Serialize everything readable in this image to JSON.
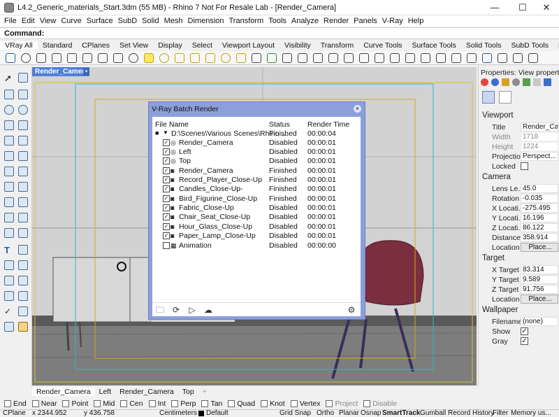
{
  "window": {
    "title": "L4.2_Generic_materials_Start.3dm (55 MB) - Rhino 7 Not For Resale Lab - [Render_Camera]",
    "controls": {
      "minimize": "—",
      "maximize": "☐",
      "close": "✕"
    }
  },
  "menu": [
    "File",
    "Edit",
    "View",
    "Curve",
    "Surface",
    "SubD",
    "Solid",
    "Mesh",
    "Dimension",
    "Transform",
    "Tools",
    "Analyze",
    "Render",
    "Panels",
    "V-Ray",
    "Help"
  ],
  "command": {
    "label": "Command:"
  },
  "toolbar_tabs": [
    "VRay All",
    "Standard",
    "CPlanes",
    "Set View",
    "Display",
    "Select",
    "Viewport Layout",
    "Visibility",
    "Transform",
    "Curve Tools",
    "Surface Tools",
    "Solid Tools",
    "SubD Tools",
    "Mesh"
  ],
  "viewport": {
    "active_tab": "Render_Camera",
    "dropdown_glyph": "▾"
  },
  "viewport_tabs": [
    "Render_Camera",
    "Left",
    "Render_Camera",
    "Top"
  ],
  "add_tab_glyph": "+",
  "batch_render": {
    "title": "V-Ray Batch Render",
    "close_glyph": "×",
    "headers": {
      "file": "File Name",
      "status": "Status",
      "time": "Render Time"
    },
    "root": {
      "name": "D:\\Scenes\\Various Scenes\\Rhino ...",
      "status": "Finished",
      "time": "00:00:04",
      "toggle": "▼",
      "marker": "■"
    },
    "rows": [
      {
        "name": "Render_Camera",
        "status": "Disabled",
        "time": "00:00:01",
        "icon": "◎",
        "checked": "✓"
      },
      {
        "name": "Left",
        "status": "Disabled",
        "time": "00:00:01",
        "icon": "◎",
        "checked": "✓"
      },
      {
        "name": "Top",
        "status": "Disabled",
        "time": "00:00:01",
        "icon": "◎",
        "checked": "✓"
      },
      {
        "name": "Render_Camera",
        "status": "Finished",
        "time": "00:00:01",
        "icon": "◙",
        "checked": "✓"
      },
      {
        "name": "Record_Player_Close-Up",
        "status": "Finished",
        "time": "00:00:01",
        "icon": "◙",
        "checked": "✓"
      },
      {
        "name": "Candles_Close-Up-",
        "status": "Finished",
        "time": "00:00:01",
        "icon": "◙",
        "checked": "✓"
      },
      {
        "name": "Bird_Figurine_Close-Up",
        "status": "Finished",
        "time": "00:00:01",
        "icon": "◙",
        "checked": "✓"
      },
      {
        "name": "Fabric_Close-Up",
        "status": "Disabled",
        "time": "00:00:01",
        "icon": "◙",
        "checked": "✓"
      },
      {
        "name": "Chair_Seat_Close-Up",
        "status": "Disabled",
        "time": "00:00:01",
        "icon": "◙",
        "checked": "✓"
      },
      {
        "name": "Hour_Glass_Close-Up",
        "status": "Disabled",
        "time": "00:00:01",
        "icon": "◙",
        "checked": "✓"
      },
      {
        "name": "Paper_Lamp_Close-Up",
        "status": "Disabled",
        "time": "00:00:01",
        "icon": "◙",
        "checked": "✓"
      },
      {
        "name": "Animation",
        "status": "Disabled",
        "time": "00:00:00",
        "icon": "▦",
        "checked": ""
      }
    ],
    "footer_icons": {
      "open": "🗀",
      "refresh": "⟳",
      "render": "▷",
      "cloud": "☁",
      "settings": "⚙"
    }
  },
  "properties": {
    "title": "Properties: View properties",
    "viewport_header": "Viewport",
    "viewport_fields": [
      {
        "label": "Title",
        "value": "Render_Ca..."
      },
      {
        "label": "Width",
        "value": "1718"
      },
      {
        "label": "Height",
        "value": "1224"
      },
      {
        "label": "Projection",
        "value": "Perspect..."
      }
    ],
    "locked_label": "Locked",
    "camera_header": "Camera",
    "camera_fields": [
      {
        "label": "Lens Le...",
        "value": "45.0"
      },
      {
        "label": "Rotation",
        "value": "-0.035"
      },
      {
        "label": "X Locati...",
        "value": "-275.495"
      },
      {
        "label": "Y Locati...",
        "value": "16.196"
      },
      {
        "label": "Z Locati...",
        "value": "86.122"
      },
      {
        "label": "Distance...",
        "value": "358.914"
      }
    ],
    "location_label": "Location",
    "place_button": "Place...",
    "target_header": "Target",
    "target_fields": [
      {
        "label": "X Target",
        "value": "83.314"
      },
      {
        "label": "Y Target",
        "value": "9.589"
      },
      {
        "label": "Z Target",
        "value": "91.756"
      }
    ],
    "wallpaper_header": "Wallpaper",
    "filename_label": "Filename",
    "filename_value": "(none)",
    "show_label": "Show",
    "gray_label": "Gray",
    "check": "✓"
  },
  "osnaps": [
    {
      "label": "End"
    },
    {
      "label": "Near"
    },
    {
      "label": "Point"
    },
    {
      "label": "Mid"
    },
    {
      "label": "Cen"
    },
    {
      "label": "Int"
    },
    {
      "label": "Perp"
    },
    {
      "label": "Tan"
    },
    {
      "label": "Quad"
    },
    {
      "label": "Knot"
    },
    {
      "label": "Vertex"
    },
    {
      "label": "Project"
    },
    {
      "label": "Disable"
    }
  ],
  "status": {
    "cplane": "CPlane",
    "x": "x 2344.952",
    "y": "y 436.758",
    "units": "Centimeters",
    "layer": "Default",
    "grid_snap": "Grid Snap",
    "ortho": "Ortho",
    "planar": "Planar",
    "osnap": "Osnap",
    "smarttrack": "SmartTrack",
    "gumball": "Gumball",
    "record_history": "Record History",
    "filter": "Filter",
    "memory": "Memory us..."
  }
}
